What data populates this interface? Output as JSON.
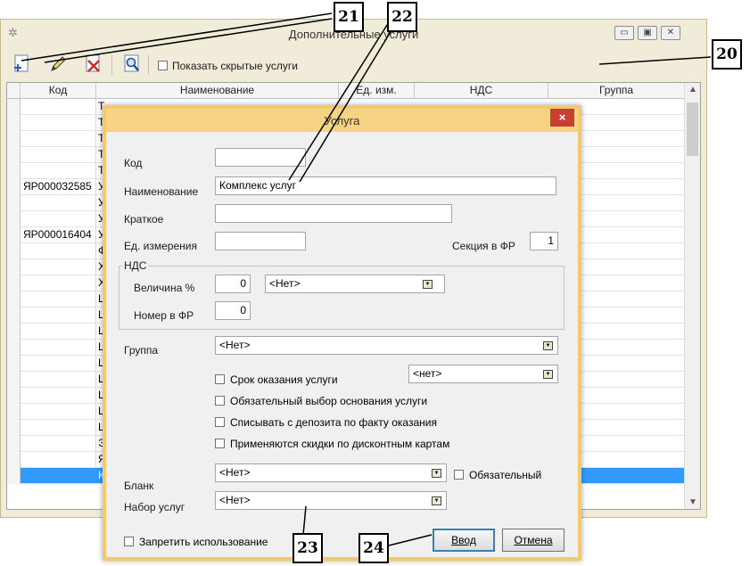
{
  "main_window": {
    "title": "Дополнительные услуги",
    "toolbar": {
      "add_icon": "add-icon",
      "edit_icon": "pencil-icon",
      "delete_icon": "delete-icon",
      "find_icon": "magnifier-icon",
      "show_hidden_label": "Показать скрытые услуги",
      "show_hidden_checked": false
    },
    "table": {
      "columns": [
        "Код",
        "Наименование",
        "Ед. изм.",
        "НДС",
        "Группа"
      ],
      "rows": [
        {
          "kod": "",
          "name": "Т"
        },
        {
          "kod": "",
          "name": "Т"
        },
        {
          "kod": "",
          "name": "Т"
        },
        {
          "kod": "",
          "name": "Т"
        },
        {
          "kod": "",
          "name": "Т"
        },
        {
          "kod": "ЯР000032585",
          "name": "У"
        },
        {
          "kod": "",
          "name": "У"
        },
        {
          "kod": "",
          "name": "У"
        },
        {
          "kod": "ЯР000016404",
          "name": "У"
        },
        {
          "kod": "",
          "name": "Ф"
        },
        {
          "kod": "",
          "name": "Х"
        },
        {
          "kod": "",
          "name": "Х"
        },
        {
          "kod": "",
          "name": "Ц"
        },
        {
          "kod": "",
          "name": "Ц"
        },
        {
          "kod": "",
          "name": "Ш"
        },
        {
          "kod": "",
          "name": "Ш"
        },
        {
          "kod": "",
          "name": "Ш"
        },
        {
          "kod": "",
          "name": "Ш"
        },
        {
          "kod": "",
          "name": "Ш"
        },
        {
          "kod": "",
          "name": "Ш"
        },
        {
          "kod": "",
          "name": "Ш"
        },
        {
          "kod": "",
          "name": "Э"
        },
        {
          "kod": "",
          "name": "Я"
        },
        {
          "kod": "",
          "name": "К"
        }
      ],
      "selected_row_index": 23
    }
  },
  "dialog": {
    "title": "Услуга",
    "close_label": "×",
    "fields": {
      "kod_label": "Код",
      "kod_value": "",
      "name_label": "Наименование",
      "name_value": "Комплекс услуг",
      "short_label": "Краткое",
      "short_value": "",
      "unit_label": "Ед. измерения",
      "unit_value": "",
      "section_label": "Секция в ФР",
      "section_value": "1"
    },
    "vat": {
      "group_title": "НДС",
      "rate_label": "Величина %",
      "rate_value": "0",
      "rate_select": "<Нет>",
      "fr_number_label": "Номер в ФР",
      "fr_number_value": "0"
    },
    "group": {
      "label": "Группа",
      "value": "<Нет>"
    },
    "options": {
      "term_label": "Срок оказания услуги",
      "term_value": "<нет>",
      "mandatory_basis_label": "Обязательный  выбор основания услуги",
      "deposit_label": "Списывать с депозита по факту оказания",
      "discount_label": "Применяются скидки по дисконтным картам"
    },
    "blank": {
      "label": "Бланк",
      "value": "<Нет>",
      "mandatory_label": "Обязательный"
    },
    "service_set": {
      "label": "Набор услуг",
      "value": "<Нет>"
    },
    "forbid_label": "Запретить использование",
    "ok_label": "Ввод",
    "cancel_label": "Отмена"
  },
  "callouts": [
    "21",
    "22",
    "20",
    "23",
    "24"
  ]
}
